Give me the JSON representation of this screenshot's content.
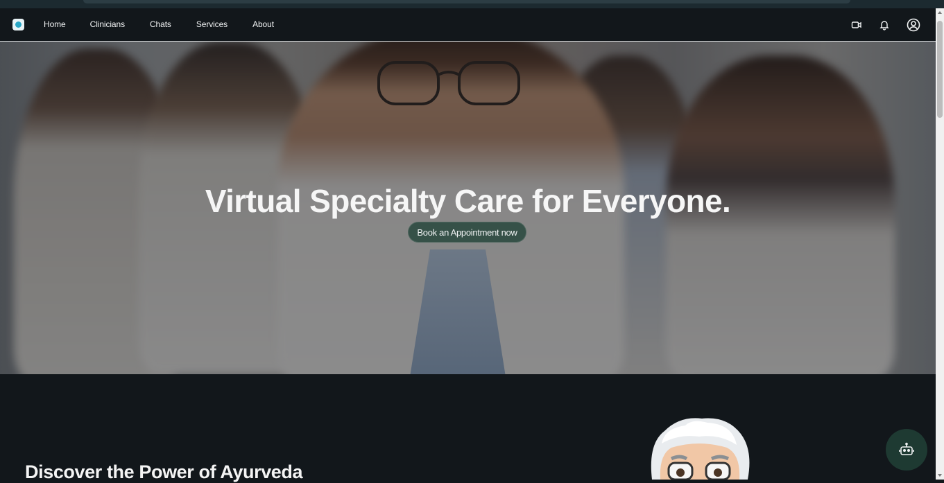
{
  "nav": {
    "logo": "app-logo",
    "links": [
      "Home",
      "Clinicians",
      "Chats",
      "Services",
      "About"
    ],
    "icons": [
      "video-camera-icon",
      "bell-icon",
      "user-circle-icon"
    ]
  },
  "hero": {
    "title": "Virtual Specialty Care for Everyone.",
    "cta_label": "Book an Appointment now"
  },
  "section": {
    "title": "Discover the Power of Ayurveda"
  },
  "chatbot": {
    "icon": "robot-icon"
  },
  "colors": {
    "background": "#12171b",
    "cta": "#25463a",
    "fab": "#1e3a32",
    "text": "#f2f4f5"
  }
}
